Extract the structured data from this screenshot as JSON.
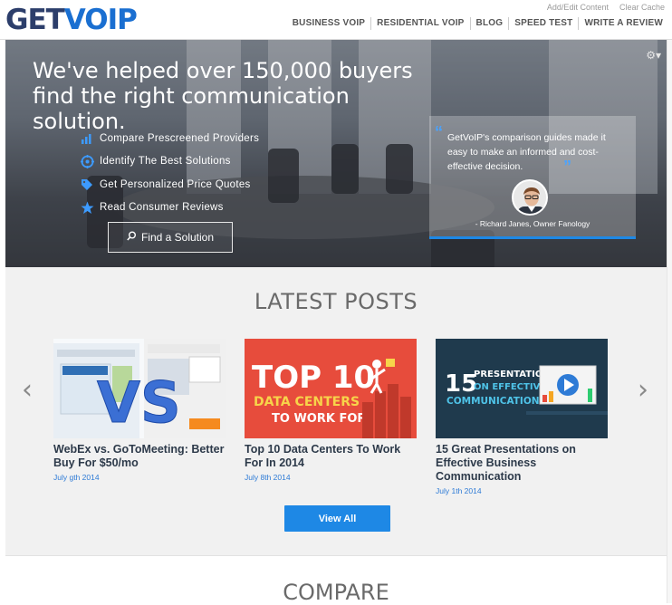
{
  "header": {
    "logo": {
      "get": "GET",
      "voip": "VOIP"
    },
    "util_links": [
      "Add/Edit Content",
      "Clear Cache"
    ],
    "nav": [
      "BUSINESS VOIP",
      "RESIDENTIAL VOIP",
      "BLOG",
      "SPEED TEST",
      "WRITE A REVIEW"
    ]
  },
  "hero": {
    "title": "We've helped over 150,000 buyers find the right communication solution.",
    "features": [
      {
        "label": "Compare Prescreened Providers",
        "icon": "bar-chart-icon"
      },
      {
        "label": "Identify The Best Solutions",
        "icon": "target-icon"
      },
      {
        "label": "Get Personalized Price Quotes",
        "icon": "tag-icon"
      },
      {
        "label": "Read Consumer Reviews",
        "icon": "star-icon"
      }
    ],
    "cta": "Find a Solution",
    "testimonial": {
      "quote": "GetVoIP's comparison guides made it easy to make an informed and cost-effective decision.",
      "attribution": "- Richard Janes, Owner Fanology"
    }
  },
  "latest_posts": {
    "title": "LATEST POSTS",
    "posts": [
      {
        "title": "WebEx vs. GoToMeeting: Better Buy For $50/mo",
        "date": "July gth 2014",
        "thumb_text": "VS"
      },
      {
        "title": "Top 10 Data Centers To Work For In 2014",
        "date": "July 8th 2014",
        "thumb_line1": "TOP 10",
        "thumb_line2": "DATA CENTERS",
        "thumb_line3": "TO WORK FOR"
      },
      {
        "title": "15 Great Presentations on Effective Business Communication",
        "date": "July 1th 2014",
        "thumb_num": "15",
        "thumb_line1": "PRESENTATIONS",
        "thumb_line2": "ON EFFECTIVE",
        "thumb_line3": "COMMUNICATION"
      }
    ],
    "view_all": "View All"
  },
  "compare": {
    "title": "COMPARE"
  },
  "colors": {
    "accent": "#1e88e5",
    "navy": "#2c3e6b",
    "red_thumb": "#e74c3c",
    "dark_thumb": "#1f3a4d"
  }
}
